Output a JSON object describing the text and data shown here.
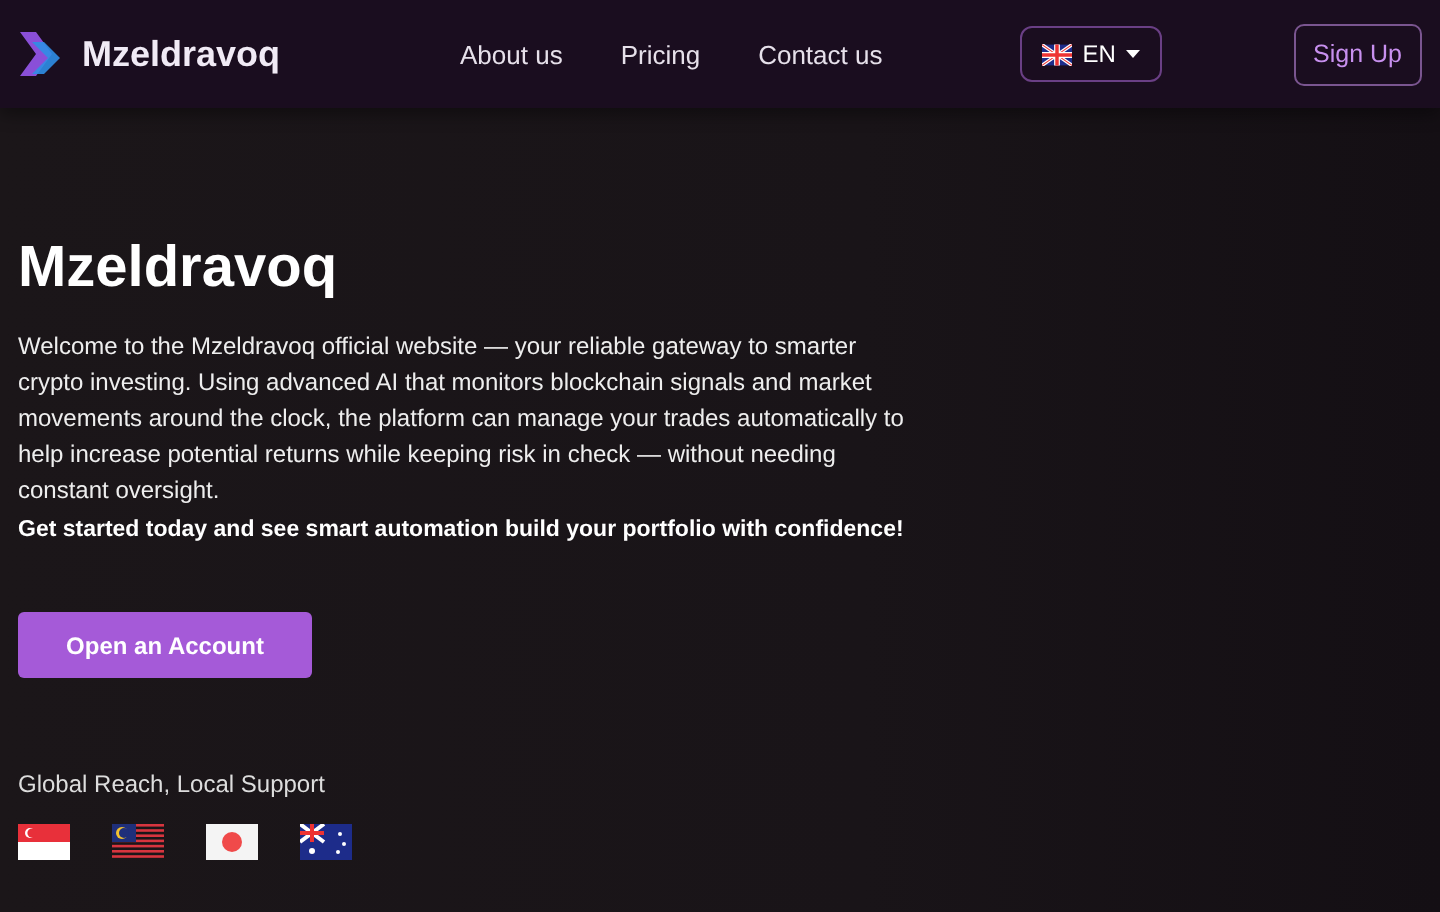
{
  "header": {
    "brand": "Mzeldravoq",
    "nav": [
      "About us",
      "Pricing",
      "Contact us"
    ],
    "language": {
      "kind": "uk",
      "code": "EN"
    },
    "signup": "Sign Up"
  },
  "hero": {
    "title": "Mzeldravoq",
    "intro": "Welcome to the Mzeldravoq official website — your reliable gateway to smarter crypto investing. Using advanced AI that monitors blockchain signals and market movements around the clock, the platform can manage your trades automatically to help increase potential returns while keeping risk in check — without needing constant oversight.",
    "cta_text": "Get started today and see smart automation build your portfolio with confidence!",
    "button": "Open an Account"
  },
  "reach": {
    "label": "Global Reach, Local Support",
    "flags": [
      {
        "kind": "sg"
      },
      {
        "kind": "my"
      },
      {
        "kind": "jp"
      },
      {
        "kind": "au"
      }
    ]
  }
}
